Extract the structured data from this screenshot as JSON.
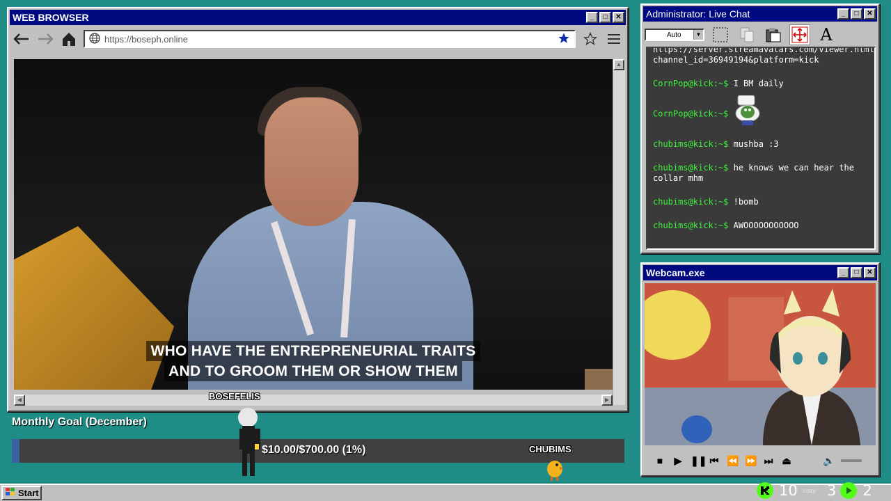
{
  "browser": {
    "title": "WEB BROWSER",
    "url": "https://boseph.online",
    "subtitle_line1": "WHO HAVE THE ENTREPRENEURIAL TRAITS",
    "subtitle_line2": "AND TO GROOM THEM OR SHOW THEM"
  },
  "chat": {
    "title": "Administrator: Live Chat",
    "font_size_select": "Auto",
    "messages": [
      {
        "user": "",
        "text": "https://server.streamavatars.com/viewer.html?channel_id=36949194&platform=kick"
      },
      {
        "user": "CornPop@kick:~$",
        "text": "I BM daily"
      },
      {
        "user": "CornPop@kick:~$",
        "text": "",
        "emote": "pepe-toilet-emote"
      },
      {
        "user": "chubims@kick:~$",
        "text": "mushba :3"
      },
      {
        "user": "chubims@kick:~$",
        "text": "he knows we can hear the collar mhm"
      },
      {
        "user": "chubims@kick:~$",
        "text": "!bomb"
      },
      {
        "user": "chubims@kick:~$",
        "text": "AWOOOOOOOOOOO"
      }
    ]
  },
  "webcam": {
    "title": "Webcam.exe"
  },
  "goal": {
    "title": "Monthly Goal (December)",
    "progress_text": "$10.00/$700.00 (1%)",
    "progress_fraction": 0.01
  },
  "avatars": {
    "left_name": "BOSEFELIS",
    "right_name": "CHUBIMS"
  },
  "taskbar": {
    "start_label": "Start",
    "stat1": "10",
    "stat2_label": "cozy",
    "stat2": "3",
    "stat3": "2"
  },
  "colors": {
    "desktop": "#1f8c86",
    "titlebar": "#000a80",
    "chat_user": "#3df23d",
    "kick_green": "#53fc18"
  }
}
